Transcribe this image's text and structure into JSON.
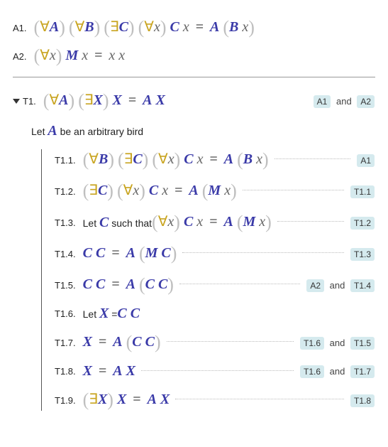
{
  "axioms": {
    "A1": {
      "label": "A1.",
      "q1": "∀",
      "v1": "A",
      "q2": "∀",
      "v2": "B",
      "q3": "∃",
      "v3": "C",
      "q4": "∀",
      "v4": "x",
      "lhs1": "C",
      "lhs2": "x",
      "eq": "=",
      "rhs1": "A",
      "rhs2": "B",
      "rhs3": "x"
    },
    "A2": {
      "label": "A2.",
      "q1": "∀",
      "v1": "x",
      "lhs1": "M",
      "lhs2": "x",
      "eq": "=",
      "rhs1": "x",
      "rhs2": "x"
    }
  },
  "T1": {
    "label": "T1.",
    "q1": "∀",
    "v1": "A",
    "q2": "∃",
    "v2": "X",
    "lhs": "X",
    "eq": "=",
    "r1": "A",
    "r2": "X",
    "just": {
      "a": "A1",
      "and": "and",
      "b": "A2"
    }
  },
  "let1": {
    "pre": "Let ",
    "var": "A",
    "post": " be an arbitrary bird"
  },
  "steps": {
    "s1": {
      "label": "T1.1.",
      "ref": "A1"
    },
    "s2": {
      "label": "T1.2.",
      "ref": "T1.1"
    },
    "s3": {
      "label": "T1.3.",
      "pre": "Let ",
      "var": "C",
      "mid": " such that ",
      "ref": "T1.2"
    },
    "s4": {
      "label": "T1.4.",
      "ref": "T1.3"
    },
    "s5": {
      "label": "T1.5.",
      "refa": "A2",
      "and": "and",
      "refb": "T1.4"
    },
    "s6": {
      "label": "T1.6.",
      "pre": "Let ",
      "var": "X",
      "eq": " = "
    },
    "s7": {
      "label": "T1.7.",
      "refa": "T1.6",
      "and": "and",
      "refb": "T1.5"
    },
    "s8": {
      "label": "T1.8.",
      "refa": "T1.6",
      "and": "and",
      "refb": "T1.7"
    },
    "s9": {
      "label": "T1.9.",
      "ref": "T1.8"
    }
  },
  "sym": {
    "fa": "∀",
    "ex": "∃",
    "eq": "=",
    "A": "A",
    "B": "B",
    "C": "C",
    "M": "M",
    "X": "X",
    "x": "x"
  }
}
